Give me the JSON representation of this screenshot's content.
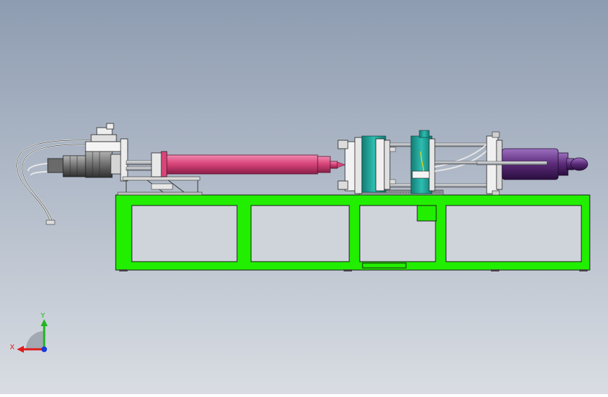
{
  "viewport": {
    "background_top": "#8e9cb1",
    "background_bottom": "#d9dde3"
  },
  "machine": {
    "frame_color": "#22ee00",
    "barrel_color": "#d9457a",
    "platen_color": "#1ea69b",
    "clamp_cylinder_color": "#5a2a78",
    "motor_color": "#6f6f6f"
  },
  "triad": {
    "x_label": "X",
    "y_label": "Y",
    "x_color": "#e01b1b",
    "y_color": "#1fb51f",
    "z_color": "#1a3ad8"
  }
}
